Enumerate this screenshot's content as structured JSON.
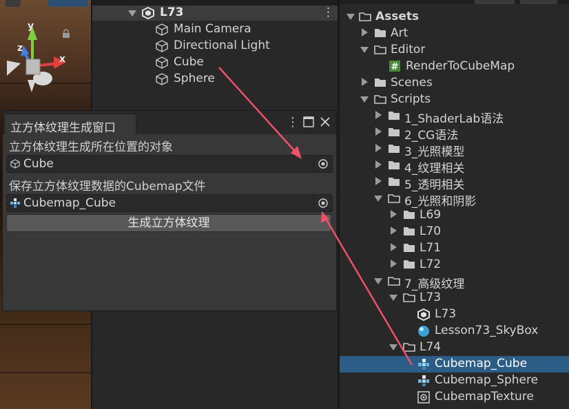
{
  "scene": {
    "axis_y": "y",
    "axis_z": "z",
    "axis_x": "x"
  },
  "hierarchy": {
    "scene_name": "L73",
    "items": [
      "Main Camera",
      "Directional Light",
      "Cube",
      "Sphere"
    ]
  },
  "project": {
    "rows": [
      {
        "label": "Assets"
      },
      {
        "label": "Art"
      },
      {
        "label": "Editor"
      },
      {
        "label": "RenderToCubeMap"
      },
      {
        "label": "Scenes"
      },
      {
        "label": "Scripts"
      },
      {
        "label": "1_ShaderLab语法"
      },
      {
        "label": "2_CG语法"
      },
      {
        "label": "3_光照模型"
      },
      {
        "label": "4_纹理相关"
      },
      {
        "label": "5_透明相关"
      },
      {
        "label": "6_光照和阴影"
      },
      {
        "label": "L69"
      },
      {
        "label": "L70"
      },
      {
        "label": "L71"
      },
      {
        "label": "L72"
      },
      {
        "label": "7_高级纹理"
      },
      {
        "label": "L73"
      },
      {
        "label": "L73"
      },
      {
        "label": "Lesson73_SkyBox"
      },
      {
        "label": "L74"
      },
      {
        "label": "Cubemap_Cube"
      },
      {
        "label": "Cubemap_Sphere"
      },
      {
        "label": "CubemapTexture"
      }
    ],
    "selected": "Cubemap_Cube"
  },
  "window": {
    "tab_title": "立方体纹理生成窗口",
    "field1_label": "立方体纹理生成所在位置的对象",
    "field1_value": "Cube",
    "field2_label": "保存立方体纹理数据的Cubemap文件",
    "field2_value": "Cubemap_Cube",
    "button_label": "生成立方体纹理"
  },
  "colors": {
    "annotation_arrow": "#f0506a",
    "selection": "#2c5d87",
    "axis_x": "#e04040",
    "axis_y": "#7fd040",
    "axis_z": "#4080e0"
  }
}
